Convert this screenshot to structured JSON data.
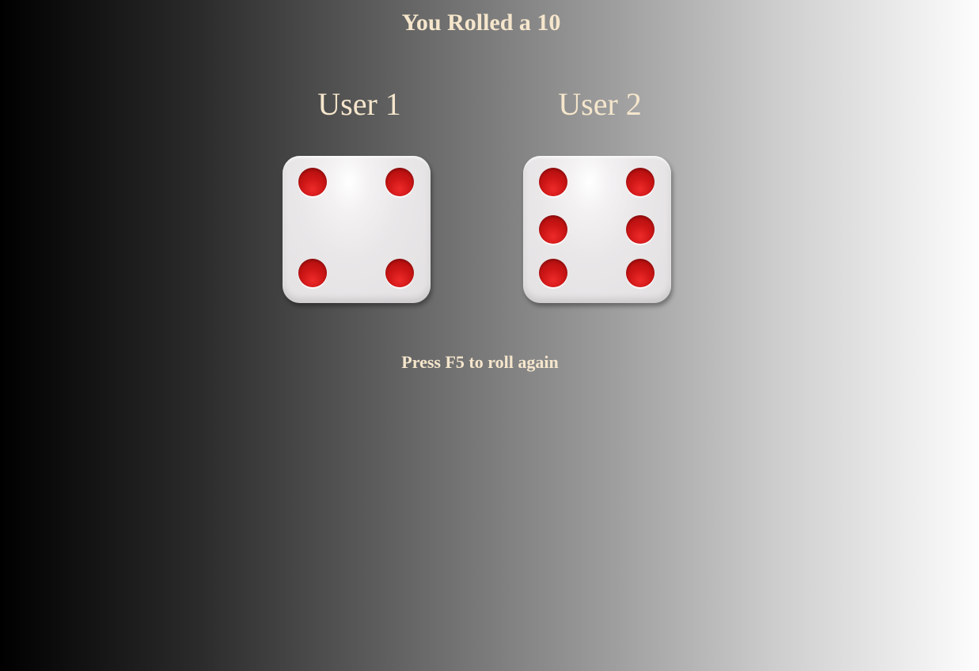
{
  "game": {
    "result_text": "You Rolled a 10",
    "hint": "Press F5 to roll again",
    "text_color": "#f5e6cc",
    "pip_color": "#cc1515",
    "die_color": "#eae8e9"
  },
  "players": [
    {
      "name": "User 1",
      "die_value": 4
    },
    {
      "name": "User 2",
      "die_value": 6
    }
  ]
}
